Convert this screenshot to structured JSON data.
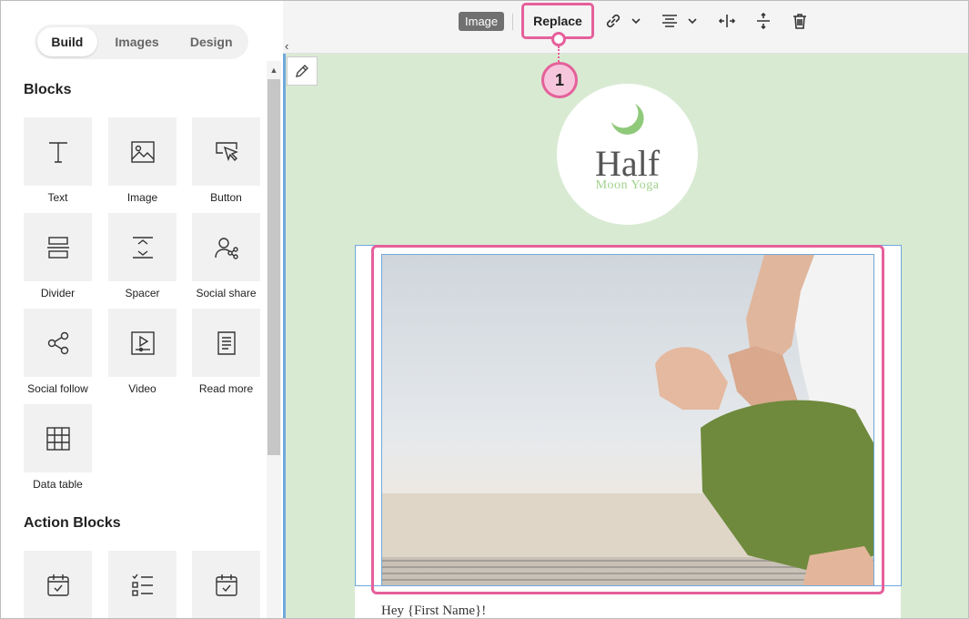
{
  "sidebar": {
    "tabs": [
      "Build",
      "Images",
      "Design"
    ],
    "blocks_title": "Blocks",
    "blocks": [
      {
        "label": "Text",
        "icon": "text-icon"
      },
      {
        "label": "Image",
        "icon": "image-icon"
      },
      {
        "label": "Button",
        "icon": "button-icon"
      },
      {
        "label": "Divider",
        "icon": "divider-icon"
      },
      {
        "label": "Spacer",
        "icon": "spacer-icon"
      },
      {
        "label": "Social share",
        "icon": "social-share-icon"
      },
      {
        "label": "Social follow",
        "icon": "social-follow-icon"
      },
      {
        "label": "Video",
        "icon": "video-icon"
      },
      {
        "label": "Read more",
        "icon": "read-more-icon"
      },
      {
        "label": "Data table",
        "icon": "data-table-icon"
      }
    ],
    "action_title": "Action Blocks"
  },
  "toolbar": {
    "image_chip": "Image",
    "replace_label": "Replace",
    "icons": [
      "link-icon",
      "chevron-down-icon",
      "align-icon",
      "chevron-down-icon",
      "resize-width-icon",
      "resize-height-icon",
      "trash-icon"
    ]
  },
  "callout": {
    "number": "1"
  },
  "email": {
    "logo_name": "Half",
    "logo_sub": "Moon Yoga",
    "greeting": "Hey {First Name}!"
  },
  "colors": {
    "highlight": "#e5609a",
    "canvas_bg": "#d9ead3",
    "selection": "#6fa8dc",
    "logo_accent": "#9fd28c"
  }
}
